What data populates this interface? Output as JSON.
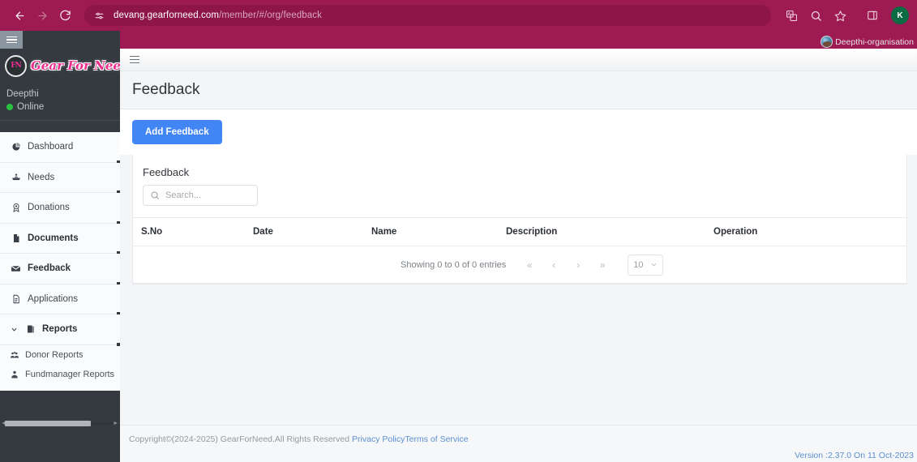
{
  "browser": {
    "url_prefix": "devang.gearforneed.com",
    "url_suffix": "/member/#/org/feedback",
    "back_icon": "back-arrow-icon",
    "forward_icon": "forward-arrow-icon",
    "reload_icon": "reload-icon",
    "site_info_icon": "site-settings-icon",
    "translate_icon": "translate-icon",
    "zoom_icon": "search-icon",
    "bookmark_icon": "star-icon",
    "side_panel_icon": "side-panel-icon",
    "profile_initial": "K",
    "accent_color": "#9d1b52"
  },
  "sidebar": {
    "toggle_icon": "hamburger-icon",
    "brand": {
      "monogram": "FN",
      "name": "Gear For Need",
      "color": "#ec2f8d"
    },
    "user": {
      "name": "Deepthi",
      "status": "Online",
      "status_color": "#28c440"
    },
    "items": [
      {
        "label": "Dashboard",
        "icon": "dashboard-pie-icon",
        "bold": false
      },
      {
        "label": "Needs",
        "icon": "needs-hand-icon",
        "bold": false
      },
      {
        "label": "Donations",
        "icon": "donations-badge-icon",
        "bold": false
      },
      {
        "label": "Documents",
        "icon": "documents-file-icon",
        "bold": true
      },
      {
        "label": "Feedback",
        "icon": "feedback-envelope-icon",
        "bold": true
      },
      {
        "label": "Applications",
        "icon": "applications-file-icon",
        "bold": false
      },
      {
        "label": "Reports",
        "icon": "reports-book-icon",
        "bold": true,
        "expanded": true
      }
    ],
    "sub_items": [
      {
        "label": "Donor Reports",
        "icon": "donor-group-icon"
      },
      {
        "label": "Fundmanager Reports",
        "icon": "fundmanager-person-icon"
      }
    ]
  },
  "topbar": {
    "hamburger_icon": "hamburger-icon",
    "org_name": "Deepthi-organisation",
    "org_avatar_icon": "organisation-avatar"
  },
  "page": {
    "title": "Feedback",
    "add_button_label": "Add Feedback"
  },
  "card": {
    "title": "Feedback",
    "search": {
      "placeholder": "Search...",
      "value": "",
      "icon": "search-icon"
    },
    "columns": [
      "S.No",
      "Date",
      "Name",
      "Description",
      "Operation"
    ],
    "rows": [],
    "pagination": {
      "info": "Showing 0 to 0 of 0 entries",
      "first_label": "«",
      "prev_label": "‹",
      "next_label": "›",
      "last_label": "»",
      "page_size": "10",
      "caret_icon": "chevron-down-icon"
    }
  },
  "footer": {
    "copyright": "Copyright©(2024-2025) GearForNeed.All Rights Reserved ",
    "privacy_label": "Privacy Policy",
    "terms_label": "Terms of Service",
    "version": "Version :2.37.0 On 11 Oct-2023"
  }
}
